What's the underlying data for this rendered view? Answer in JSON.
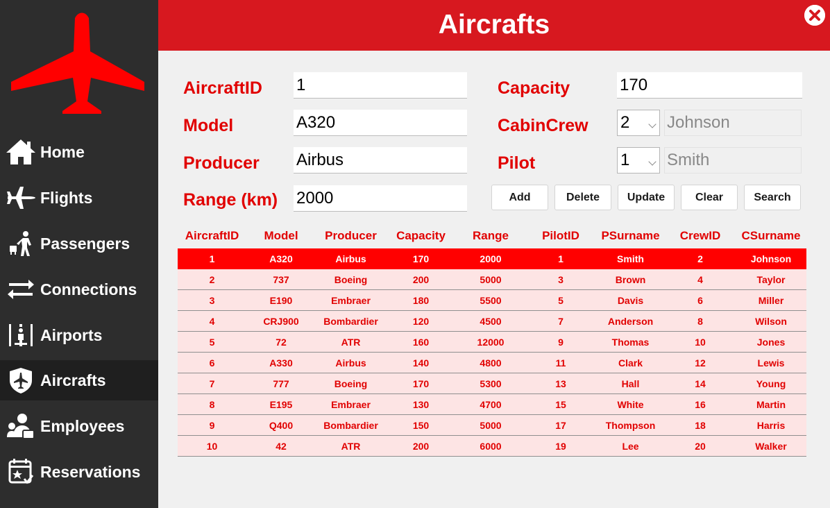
{
  "header": {
    "title": "Aircrafts"
  },
  "sidebar": {
    "items": [
      {
        "label": "Home",
        "icon": "home-icon"
      },
      {
        "label": "Flights",
        "icon": "plane-icon"
      },
      {
        "label": "Passengers",
        "icon": "passenger-icon"
      },
      {
        "label": "Connections",
        "icon": "arrows-icon"
      },
      {
        "label": "Airports",
        "icon": "airport-icon"
      },
      {
        "label": "Aircrafts",
        "icon": "aircraft-shield-icon",
        "active": true
      },
      {
        "label": "Employees",
        "icon": "employees-icon"
      },
      {
        "label": "Reservations",
        "icon": "calendar-star-icon"
      }
    ]
  },
  "form": {
    "aircraftid_label": "AircraftID",
    "aircraftid_value": "1",
    "model_label": "Model",
    "model_value": "A320",
    "producer_label": "Producer",
    "producer_value": "Airbus",
    "range_label": "Range (km)",
    "range_value": "2000",
    "capacity_label": "Capacity",
    "capacity_value": "170",
    "cabincrew_label": "CabinCrew",
    "cabincrew_value": "2",
    "cabincrew_name": "Johnson",
    "pilot_label": "Pilot",
    "pilot_value": "1",
    "pilot_name": "Smith"
  },
  "buttons": {
    "add": "Add",
    "delete": "Delete",
    "update": "Update",
    "clear": "Clear",
    "search": "Search"
  },
  "table": {
    "columns": [
      "AircraftID",
      "Model",
      "Producer",
      "Capacity",
      "Range",
      "PilotID",
      "PSurname",
      "CrewID",
      "CSurname"
    ],
    "rows": [
      [
        "1",
        "A320",
        "Airbus",
        "170",
        "2000",
        "1",
        "Smith",
        "2",
        "Johnson"
      ],
      [
        "2",
        "737",
        "Boeing",
        "200",
        "5000",
        "3",
        "Brown",
        "4",
        "Taylor"
      ],
      [
        "3",
        "E190",
        "Embraer",
        "180",
        "5500",
        "5",
        "Davis",
        "6",
        "Miller"
      ],
      [
        "4",
        "CRJ900",
        "Bombardier",
        "120",
        "4500",
        "7",
        "Anderson",
        "8",
        "Wilson"
      ],
      [
        "5",
        "72",
        "ATR",
        "160",
        "12000",
        "9",
        "Thomas",
        "10",
        "Jones"
      ],
      [
        "6",
        "A330",
        "Airbus",
        "140",
        "4800",
        "11",
        "Clark",
        "12",
        "Lewis"
      ],
      [
        "7",
        "777",
        "Boeing",
        "170",
        "5300",
        "13",
        "Hall",
        "14",
        "Young"
      ],
      [
        "8",
        "E195",
        "Embraer",
        "130",
        "4700",
        "15",
        "White",
        "16",
        "Martin"
      ],
      [
        "9",
        "Q400",
        "Bombardier",
        "150",
        "5000",
        "17",
        "Thompson",
        "18",
        "Harris"
      ],
      [
        "10",
        "42",
        "ATR",
        "200",
        "6000",
        "19",
        "Lee",
        "20",
        "Walker"
      ]
    ],
    "selected_row": 0
  },
  "colors": {
    "accent": "#d7181f",
    "text_red": "#e10000",
    "sidebar_bg": "#2d2d2d",
    "row_bg": "#fde4e4",
    "selected_bg": "#ff0000"
  }
}
